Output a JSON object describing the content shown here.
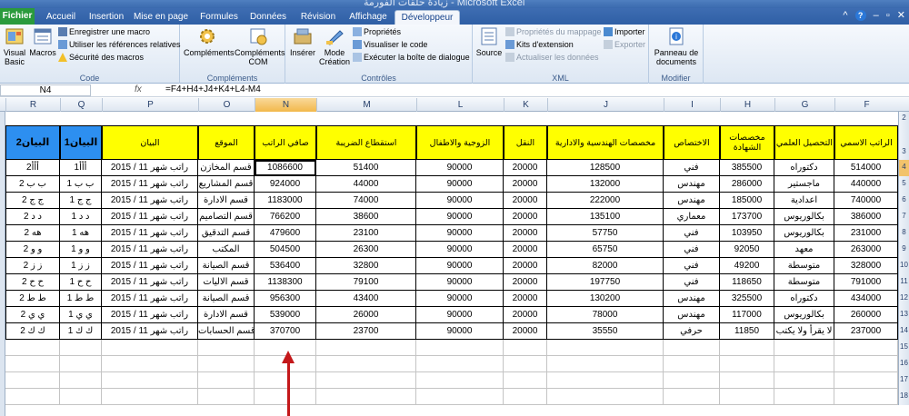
{
  "window": {
    "title": "زيادة حلقات الفورمة - Microsoft Excel"
  },
  "tabs": [
    "Fichier",
    "Accueil",
    "Insertion",
    "Mise en page",
    "Formules",
    "Données",
    "Révision",
    "Affichage",
    "Développeur"
  ],
  "ribbon": {
    "code": {
      "label": "Code",
      "visual_basic": "Visual\nBasic",
      "macros": "Macros",
      "record": "Enregistrer une macro",
      "relative": "Utiliser les références relatives",
      "security": "Sécurité des macros"
    },
    "addins": {
      "label": "Compléments",
      "complements": "Compléments",
      "com": "Compléments\nCOM"
    },
    "controls": {
      "label": "Contrôles",
      "insert": "Insérer",
      "design": "Mode\nCréation",
      "properties": "Propriétés",
      "view_code": "Visualiser le code",
      "run_dialog": "Exécuter la boîte de dialogue"
    },
    "xml": {
      "label": "XML",
      "source": "Source",
      "map_props": "Propriétés du mappage",
      "ext_packs": "Kits d'extension",
      "refresh": "Actualiser les données",
      "import": "Importer",
      "export": "Exporter"
    },
    "modify": {
      "label": "Modifier",
      "doc_panel": "Panneau de\ndocuments"
    }
  },
  "formula_bar": {
    "name_box": "N4",
    "fx": "fx",
    "formula": "=F4+H4+J4+K4+L4-M4"
  },
  "columns": [
    "R",
    "Q",
    "P",
    "O",
    "N",
    "M",
    "L",
    "K",
    "J",
    "I",
    "H",
    "G",
    "F"
  ],
  "row_numbers": [
    "2",
    "3",
    "4",
    "5",
    "6",
    "7",
    "8",
    "9",
    "10",
    "11",
    "12",
    "13",
    "14",
    "15",
    "16",
    "17",
    "18"
  ],
  "headers": {
    "R": "البيان2",
    "Q": "البيان1",
    "P": "البيان",
    "O": "الموقع",
    "N": "صافي الراتب",
    "M": "استقطاع الضريبة",
    "L": "الزوجية والاطفال",
    "K": "النقل",
    "J": "مخصصات الهندسية والادارية",
    "I": "الاختصاص",
    "H": "مخصصات الشهادة",
    "G": "التحصيل العلمي",
    "F": "الراتب الاسمي"
  },
  "rows": [
    {
      "R": "2أأأ",
      "Q": "1أأأ",
      "P": "راتب شهر 11 / 2015",
      "O": "قسم المخازن",
      "N": "1086600",
      "M": "51400",
      "L": "90000",
      "K": "20000",
      "J": "128500",
      "I": "فني",
      "H": "385500",
      "G": "دكتوراه",
      "F": "514000"
    },
    {
      "R": "ب ب 2",
      "Q": "ب ب 1",
      "P": "راتب شهر 11 / 2015",
      "O": "قسم المشاريع",
      "N": "924000",
      "M": "44000",
      "L": "90000",
      "K": "20000",
      "J": "132000",
      "I": "مهندس",
      "H": "286000",
      "G": "ماجستير",
      "F": "440000"
    },
    {
      "R": "ج ج 2",
      "Q": "ج ج 1",
      "P": "راتب شهر 11 / 2015",
      "O": "قسم الادارة",
      "N": "1183000",
      "M": "74000",
      "L": "90000",
      "K": "20000",
      "J": "222000",
      "I": "مهندس",
      "H": "185000",
      "G": "اعدادية",
      "F": "740000"
    },
    {
      "R": "د د 2",
      "Q": "د د 1",
      "P": "راتب شهر 11 / 2015",
      "O": "قسم التصاميم",
      "N": "766200",
      "M": "38600",
      "L": "90000",
      "K": "20000",
      "J": "135100",
      "I": "معماري",
      "H": "173700",
      "G": "بكالوريوس",
      "F": "386000"
    },
    {
      "R": "هه 2",
      "Q": "هه 1",
      "P": "راتب شهر 11 / 2015",
      "O": "قسم التدقيق",
      "N": "479600",
      "M": "23100",
      "L": "90000",
      "K": "20000",
      "J": "57750",
      "I": "فني",
      "H": "103950",
      "G": "بكالوريوس",
      "F": "231000"
    },
    {
      "R": "و و 2",
      "Q": "و و 1",
      "P": "راتب شهر 11 / 2015",
      "O": "المكتب",
      "N": "504500",
      "M": "26300",
      "L": "90000",
      "K": "20000",
      "J": "65750",
      "I": "فني",
      "H": "92050",
      "G": "معهد",
      "F": "263000"
    },
    {
      "R": "ز ز 2",
      "Q": "ز ز 1",
      "P": "راتب شهر 11 / 2015",
      "O": "قسم الصيانة",
      "N": "536400",
      "M": "32800",
      "L": "90000",
      "K": "20000",
      "J": "82000",
      "I": "فني",
      "H": "49200",
      "G": "متوسطة",
      "F": "328000"
    },
    {
      "R": "ح ح 2",
      "Q": "ح ح 1",
      "P": "راتب شهر 11 / 2015",
      "O": "قسم الاليات",
      "N": "1138300",
      "M": "79100",
      "L": "90000",
      "K": "20000",
      "J": "197750",
      "I": "فني",
      "H": "118650",
      "G": "متوسطة",
      "F": "791000"
    },
    {
      "R": "ط ط 2",
      "Q": "ط ط 1",
      "P": "راتب شهر 11 / 2015",
      "O": "قسم الصيانة",
      "N": "956300",
      "M": "43400",
      "L": "90000",
      "K": "20000",
      "J": "130200",
      "I": "مهندس",
      "H": "325500",
      "G": "دكتوراه",
      "F": "434000"
    },
    {
      "R": "ي ي 2",
      "Q": "ي ي 1",
      "P": "راتب شهر 11 / 2015",
      "O": "قسم الادارة",
      "N": "539000",
      "M": "26000",
      "L": "90000",
      "K": "20000",
      "J": "78000",
      "I": "مهندس",
      "H": "117000",
      "G": "بكالوريوس",
      "F": "260000"
    },
    {
      "R": "ك ك 2",
      "Q": "ك ك 1",
      "P": "راتب شهر 11 / 2015",
      "O": "قسم الحسابات",
      "N": "370700",
      "M": "23700",
      "L": "90000",
      "K": "20000",
      "J": "35550",
      "I": "حرفي",
      "H": "11850",
      "G": "لا يقرأ ولا يكتب",
      "F": "237000"
    }
  ],
  "colors": {
    "header_yellow": "#ffff00",
    "header_blue": "#2d8ff0",
    "arrow": "#c4181a",
    "file_tab": "#2a9a3c"
  }
}
